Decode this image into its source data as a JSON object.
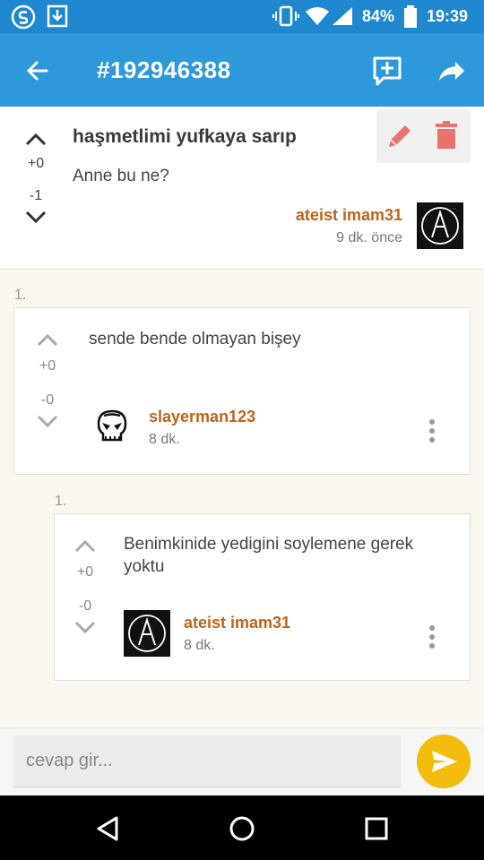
{
  "status_bar": {
    "battery": "84%",
    "time": "19:39"
  },
  "app_bar": {
    "title": "#192946388"
  },
  "post": {
    "title": "haşmetlimi yufkaya sarıp",
    "body": "Anne bu ne?",
    "upvotes": "+0",
    "downvotes": "-1",
    "author": "ateist imam31",
    "time": "9 dk. önce"
  },
  "comments": [
    {
      "index": "1.",
      "text": "sende bende olmayan bişey",
      "upvotes": "+0",
      "downvotes": "-0",
      "author": "slayerman123",
      "time": "8 dk."
    },
    {
      "index": "1.",
      "text": "Benimkinide yedigini soylemene gerek yoktu",
      "upvotes": "+0",
      "downvotes": "-0",
      "author": "ateist imam31",
      "time": "8 dk."
    }
  ],
  "reply": {
    "placeholder": "cevap gir..."
  },
  "colors": {
    "app_bar": "#2d98da",
    "accent_author": "#c0641a",
    "send_button": "#f2bd0d",
    "edit_icon": "#e8746d"
  }
}
